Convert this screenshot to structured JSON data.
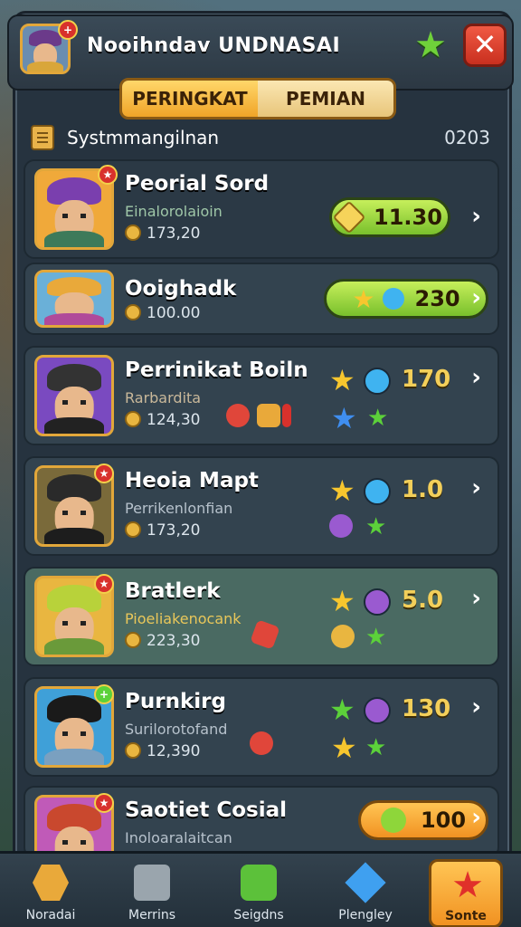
{
  "header": {
    "title": "Nooihndav UNDNASAI",
    "avatar_badge": "+",
    "star_button_icon": "star-icon",
    "close_button_glyph": "✕"
  },
  "tabs": [
    {
      "label": "PERINGKAT",
      "active": true
    },
    {
      "label": "PEMIAN",
      "active": false
    }
  ],
  "subheader": {
    "label": "Systmmangilnan",
    "count": "0203"
  },
  "players": [
    {
      "name": "Peorial Sord",
      "subtitle": "Einalorolaioin",
      "stat": "173,20",
      "score": "11.30",
      "score_style": "green-pill"
    },
    {
      "name": "Ooighadk",
      "subtitle": "",
      "stat": "100.00",
      "score": "230",
      "score_style": "green-pill"
    },
    {
      "name": "Perrinikat Boiln",
      "subtitle": "Rarbardita",
      "stat": "124,30",
      "score": "170",
      "score_style": "plain"
    },
    {
      "name": "Heoia Mapt",
      "subtitle": "Perrikenlonfian",
      "stat": "173,20",
      "score": "1.0",
      "score_style": "plain"
    },
    {
      "name": "Bratlerk",
      "subtitle": "Pioeliakenocank",
      "stat": "223,30",
      "score": "5.0",
      "score_style": "plain"
    },
    {
      "name": "Purnkirg",
      "subtitle": "Surilorotofand",
      "stat": "12,390",
      "score": "130",
      "score_style": "plain"
    },
    {
      "name": "Saotiet Cosial",
      "subtitle": "Inoloaralaitcan",
      "stat": "",
      "score": "100",
      "score_style": "orange-pill"
    }
  ],
  "nav": [
    {
      "label": "Noradai",
      "icon": "hexagon-icon"
    },
    {
      "label": "Merrins",
      "icon": "box-icon"
    },
    {
      "label": "Seigdns",
      "icon": "chat-icon"
    },
    {
      "label": "Plengley",
      "icon": "gem-icon"
    },
    {
      "label": "Sonte",
      "icon": "star-icon",
      "active": true
    }
  ],
  "colors": {
    "accent": "#f0a428",
    "panel": "#26333f",
    "positive": "#79c02c"
  }
}
